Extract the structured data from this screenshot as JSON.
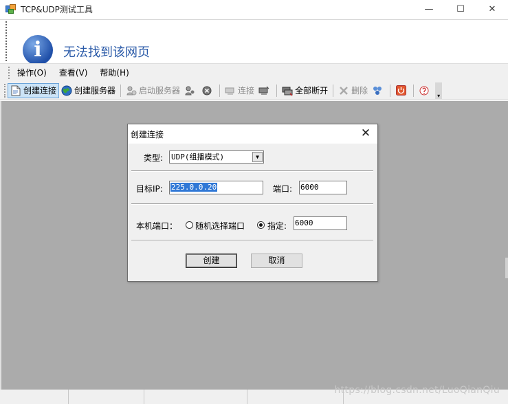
{
  "window": {
    "title": "TCP&UDP测试工具",
    "minimize": "—",
    "maximize": "☐",
    "close": "✕"
  },
  "info": {
    "icon_letter": "i",
    "message": "无法找到该网页"
  },
  "menu": {
    "items": [
      "操作(O)",
      "查看(V)",
      "帮助(H)"
    ]
  },
  "toolbar": {
    "create_connection": "创建连接",
    "create_server": "创建服务器",
    "start_server": "启动服务器",
    "connect": "连接",
    "disconnect_all": "全部断开",
    "delete": "删除"
  },
  "dialog": {
    "title": "创建连接",
    "close": "✕",
    "type_label": "类型:",
    "type_value": "UDP(组播模式)",
    "target_ip_label": "目标IP:",
    "target_ip_value": "225.0.0.20",
    "port_label": "端口:",
    "port_value": "6000",
    "local_port_label": "本机端口：",
    "random_port_label": "随机选择端口",
    "specify_label": "指定:",
    "specify_value": "6000",
    "create_button": "创建",
    "cancel_button": "取消"
  },
  "watermark": "https://blog.csdn.net/LuoQianQiu"
}
